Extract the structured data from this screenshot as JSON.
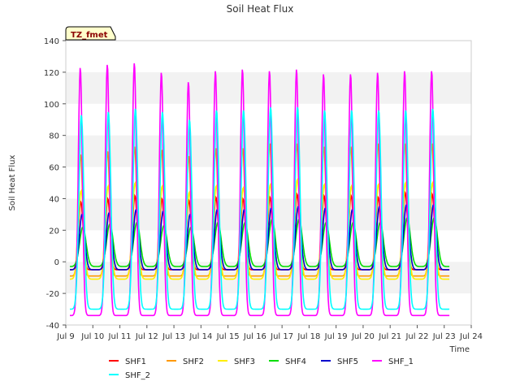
{
  "chart_data": {
    "type": "line",
    "title": "Soil Heat Flux",
    "xlabel": "Time",
    "ylabel": "Soil Heat Flux",
    "tag": "TZ_fmet",
    "xlim": [
      9,
      24
    ],
    "ylim": [
      -40,
      140
    ],
    "x_ticks": [
      {
        "value": 9,
        "label": "Jul 9"
      },
      {
        "value": 10,
        "label": "Jul 10"
      },
      {
        "value": 11,
        "label": "Jul 11"
      },
      {
        "value": 12,
        "label": "Jul 12"
      },
      {
        "value": 13,
        "label": "Jul 13"
      },
      {
        "value": 14,
        "label": "Jul 14"
      },
      {
        "value": 15,
        "label": "Jul 15"
      },
      {
        "value": 16,
        "label": "Jul 16"
      },
      {
        "value": 17,
        "label": "Jul 17"
      },
      {
        "value": 18,
        "label": "Jul 18"
      },
      {
        "value": 19,
        "label": "Jul 19"
      },
      {
        "value": 20,
        "label": "Jul 20"
      },
      {
        "value": 21,
        "label": "Jul 21"
      },
      {
        "value": 22,
        "label": "Jul 22"
      },
      {
        "value": 23,
        "label": "Jul 23"
      },
      {
        "value": 24,
        "label": "Jul 24"
      }
    ],
    "y_ticks": [
      -40,
      -20,
      0,
      20,
      40,
      60,
      80,
      100,
      120,
      140
    ],
    "grid": "horizontal bands",
    "legend_position": "bottom",
    "series": [
      {
        "name": "SHF1",
        "color": "#ff0000",
        "base": -5,
        "peak_time": 0.555,
        "width": 0.085,
        "peaks": [
          38,
          40,
          42,
          40,
          39,
          41,
          40,
          41,
          43,
          42,
          42,
          41,
          44,
          43
        ]
      },
      {
        "name": "SHF2",
        "color": "#ff9900",
        "base": -9,
        "peak_time": 0.545,
        "width": 0.08,
        "peaks": [
          68,
          70,
          73,
          71,
          67,
          72,
          72,
          75,
          75,
          73,
          73,
          75,
          75,
          75
        ]
      },
      {
        "name": "SHF3",
        "color": "#ffee00",
        "base": -11,
        "peak_time": 0.565,
        "width": 0.1,
        "peaks": [
          45,
          48,
          50,
          48,
          44,
          48,
          47,
          49,
          52,
          49,
          48,
          49,
          50,
          50
        ]
      },
      {
        "name": "SHF4",
        "color": "#00dd00",
        "base": -3,
        "peak_time": 0.63,
        "width": 0.12,
        "peaks": [
          22,
          24,
          25,
          23,
          22,
          25,
          25,
          27,
          27,
          25,
          25,
          25,
          28,
          28
        ]
      },
      {
        "name": "SHF5",
        "color": "#0000cc",
        "base": -5,
        "peak_time": 0.6,
        "width": 0.1,
        "peaks": [
          30,
          31,
          33,
          32,
          30,
          33,
          33,
          34,
          35,
          34,
          33,
          35,
          36,
          36
        ]
      },
      {
        "name": "SHF_1",
        "color": "#ff00ff",
        "base": -34,
        "peak_time": 0.535,
        "width": 0.075,
        "peaks": [
          123,
          125,
          126,
          120,
          114,
          121,
          122,
          121,
          122,
          119,
          119,
          120,
          121,
          121
        ]
      },
      {
        "name": "SHF_2",
        "color": "#00ffff",
        "base": -30,
        "peak_time": 0.575,
        "width": 0.09,
        "peaks": [
          93,
          95,
          97,
          95,
          90,
          96,
          96,
          98,
          98,
          96,
          96,
          96,
          96,
          97
        ]
      }
    ]
  }
}
